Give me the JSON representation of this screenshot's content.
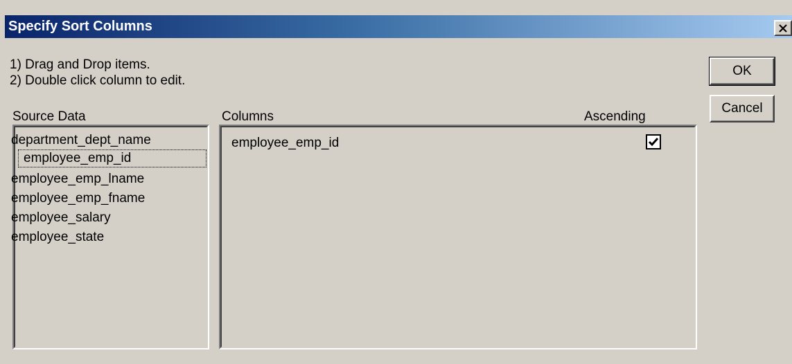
{
  "window": {
    "title": "Specify Sort Columns",
    "close_icon": "close-icon"
  },
  "instructions": [
    "1) Drag and Drop items.",
    "2) Double click column to edit."
  ],
  "source": {
    "label": "Source Data",
    "items": [
      "department_dept_name",
      "employee_emp_id",
      "employee_emp_lname",
      "employee_emp_fname",
      "employee_salary",
      "employee_state"
    ],
    "focused_index": 1
  },
  "columns": {
    "label": "Columns",
    "ascending_label": "Ascending",
    "rows": [
      {
        "name": "employee_emp_id",
        "ascending": true
      }
    ]
  },
  "buttons": {
    "ok": "OK",
    "cancel": "Cancel"
  },
  "colors": {
    "dialog_bg": "#d4d0c8",
    "title_start": "#0a246a",
    "title_end": "#a6caf0"
  }
}
